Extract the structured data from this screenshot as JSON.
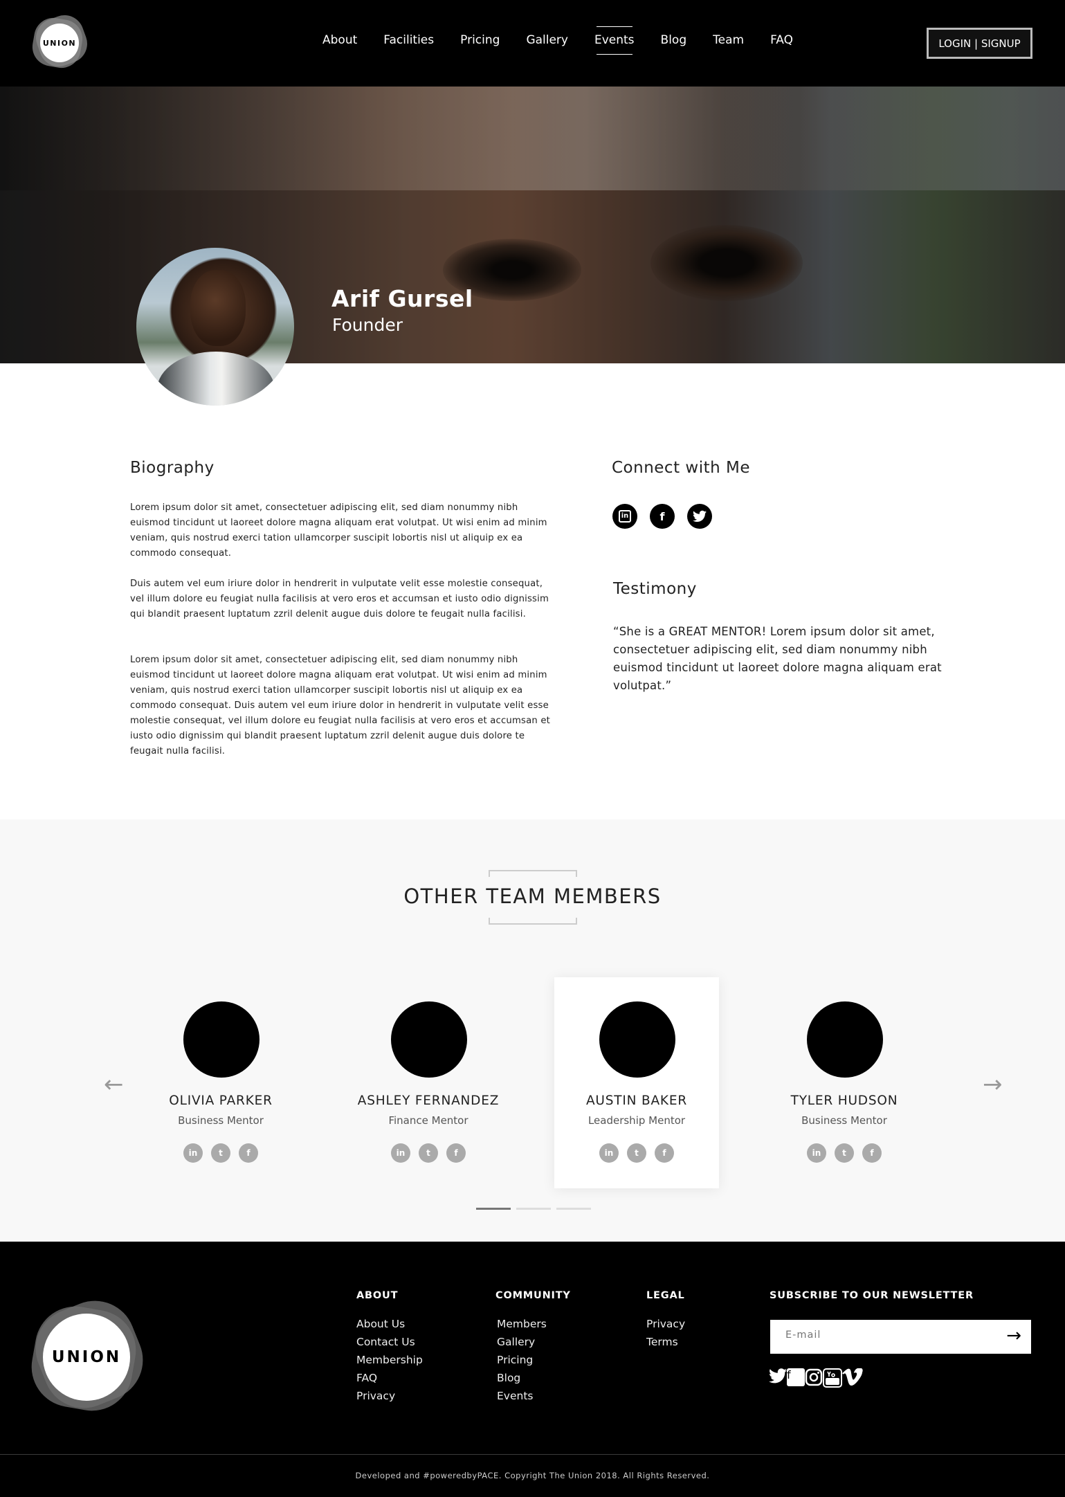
{
  "header": {
    "logo_text": "UNION",
    "nav": [
      "About",
      "Facilities",
      "Pricing",
      "Gallery",
      "Events",
      "Blog",
      "Team",
      "FAQ"
    ],
    "active_nav": "Events",
    "login_label": "LOGIN | SIGNUP"
  },
  "profile": {
    "name": "Arif Gursel",
    "role": "Founder"
  },
  "biography": {
    "heading": "Biography",
    "paragraphs": [
      "Lorem ipsum dolor sit amet, consectetuer adipiscing elit, sed diam nonummy nibh euismod tincidunt ut laoreet dolore magna aliquam erat volutpat. Ut wisi enim ad minim veniam, quis nostrud exerci tation ullamcorper suscipit lobortis nisl ut aliquip ex ea commodo consequat.",
      "Duis autem vel eum iriure dolor in hendrerit in vulputate velit esse molestie consequat, vel illum dolore eu feugiat nulla facilisis at vero eros et accumsan et iusto odio dignissim qui blandit praesent luptatum zzril delenit augue duis dolore te feugait nulla facilisi.",
      "Lorem ipsum dolor sit amet, consectetuer adipiscing elit, sed diam nonummy nibh euismod tincidunt ut laoreet dolore magna aliquam erat volutpat. Ut wisi enim ad minim veniam, quis nostrud exerci tation ullamcorper suscipit lobortis nisl ut aliquip ex ea commodo consequat. Duis autem vel eum iriure dolor in hendrerit in vulputate velit esse molestie consequat, vel illum dolore eu feugiat nulla facilisis at vero eros et accumsan et iusto odio dignissim qui blandit praesent luptatum zzril delenit augue duis dolore te feugait nulla facilisi."
    ]
  },
  "connect": {
    "heading": "Connect with Me",
    "icons": [
      "linkedin-icon",
      "facebook-icon",
      "twitter-icon"
    ]
  },
  "testimony": {
    "heading": "Testimony",
    "text": "“She is a GREAT MENTOR! Lorem ipsum dolor sit amet, consectetuer adipiscing elit, sed diam nonummy nibh euismod tincidunt ut laoreet dolore magna aliquam erat volutpat.”"
  },
  "team": {
    "title": "OTHER TEAM MEMBERS",
    "members": [
      {
        "name": "OLIVIA PARKER",
        "role": "Business Mentor"
      },
      {
        "name": "ASHLEY FERNANDEZ",
        "role": "Finance Mentor"
      },
      {
        "name": "AUSTIN BAKER",
        "role": "Leadership Mentor"
      },
      {
        "name": "TYLER HUDSON",
        "role": "Business Mentor"
      }
    ],
    "featured_index": 2,
    "prev_arrow": "←",
    "next_arrow": "→",
    "pages": 3,
    "current_page": 1
  },
  "footer": {
    "logo_text": "UNION",
    "columns": [
      {
        "title": "ABOUT",
        "links": [
          "About Us",
          "Contact Us",
          "Membership",
          "FAQ",
          "Privacy"
        ]
      },
      {
        "title": "COMMUNITY",
        "links": [
          "Members",
          "Gallery",
          "Pricing",
          "Blog",
          "Events"
        ]
      },
      {
        "title": "LEGAL",
        "links": [
          "Privacy",
          "Terms"
        ]
      }
    ],
    "newsletter": {
      "title": "SUBSCRIBE TO OUR NEWSLETTER",
      "placeholder": "E-mail",
      "submit_icon": "arrow-right-icon"
    },
    "social_icons": [
      "twitter-icon",
      "facebook-icon",
      "instagram-icon",
      "youtube-icon",
      "vimeo-icon"
    ],
    "copyright": "Developed and #poweredbyPACE. Copyright The Union 2018. All Rights Reserved."
  },
  "colors": {
    "header_bg": "#000000",
    "footer_bg": "#000000",
    "team_bg": "#f8f8f8",
    "icon_grey": "#aaaaaa"
  }
}
